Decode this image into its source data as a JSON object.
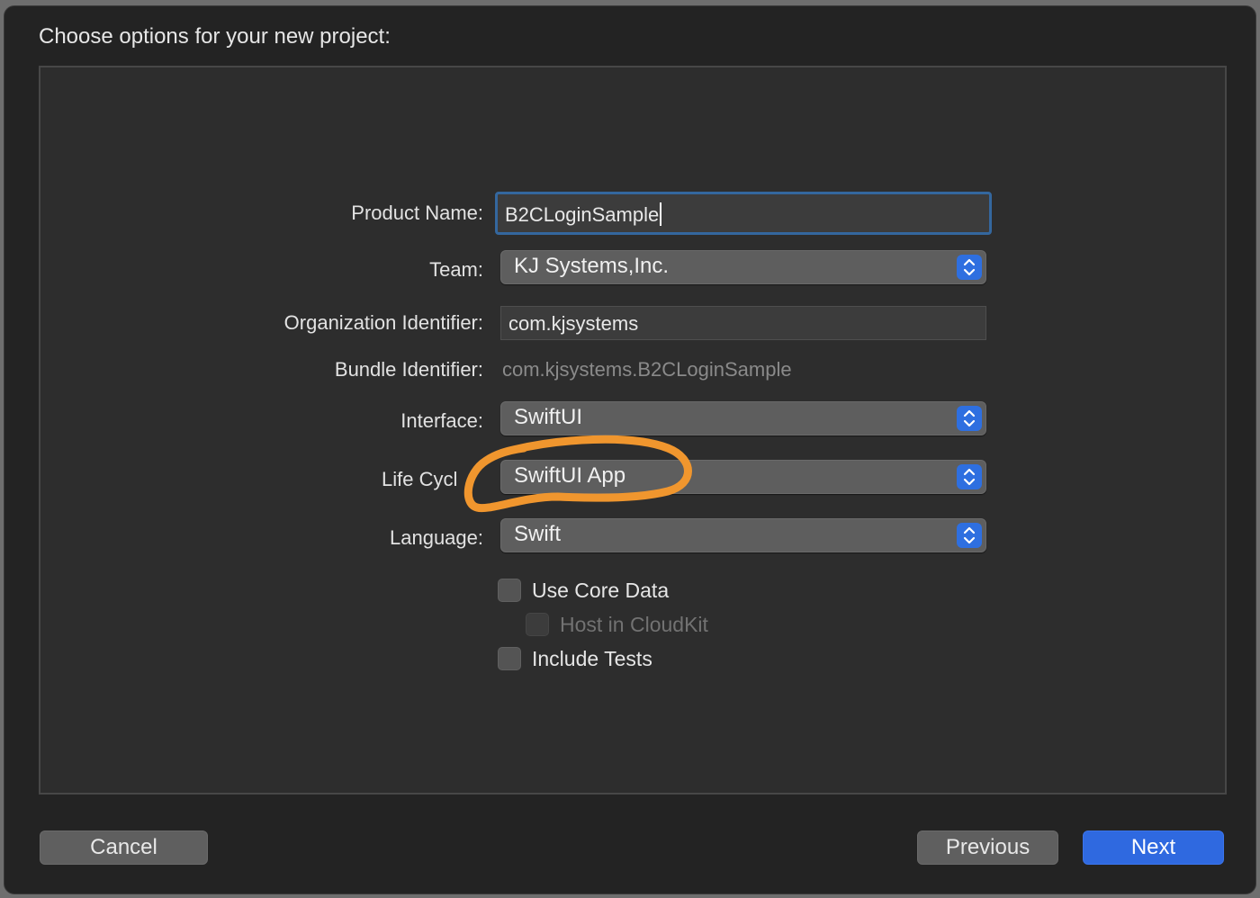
{
  "dialog": {
    "title": "Choose options for your new project:"
  },
  "form": {
    "product_name": {
      "label": "Product Name:",
      "value": "B2CLoginSample"
    },
    "team": {
      "label": "Team:",
      "value": "KJ Systems,Inc."
    },
    "organization_identifier": {
      "label": "Organization Identifier:",
      "value": "com.kjsystems"
    },
    "bundle_identifier": {
      "label": "Bundle Identifier:",
      "value": "com.kjsystems.B2CLoginSample"
    },
    "interface": {
      "label": "Interface:",
      "value": "SwiftUI"
    },
    "life_cycle": {
      "label": "Life Cycl",
      "value": "SwiftUI App"
    },
    "language": {
      "label": "Language:",
      "value": "Swift"
    },
    "options": [
      {
        "label": "Use Core Data",
        "checked": false,
        "enabled": true
      },
      {
        "label": "Host in CloudKit",
        "checked": false,
        "enabled": false
      },
      {
        "label": "Include Tests",
        "checked": false,
        "enabled": true
      }
    ]
  },
  "buttons": {
    "cancel": "Cancel",
    "previous": "Previous",
    "next": "Next"
  },
  "colors": {
    "accent": "#2f69e0",
    "annotation": "#f0962e",
    "background": "#232323"
  },
  "icons": {
    "popup_stepper": "chevron-up-down-icon",
    "annotation": "hand-drawn-circle"
  }
}
